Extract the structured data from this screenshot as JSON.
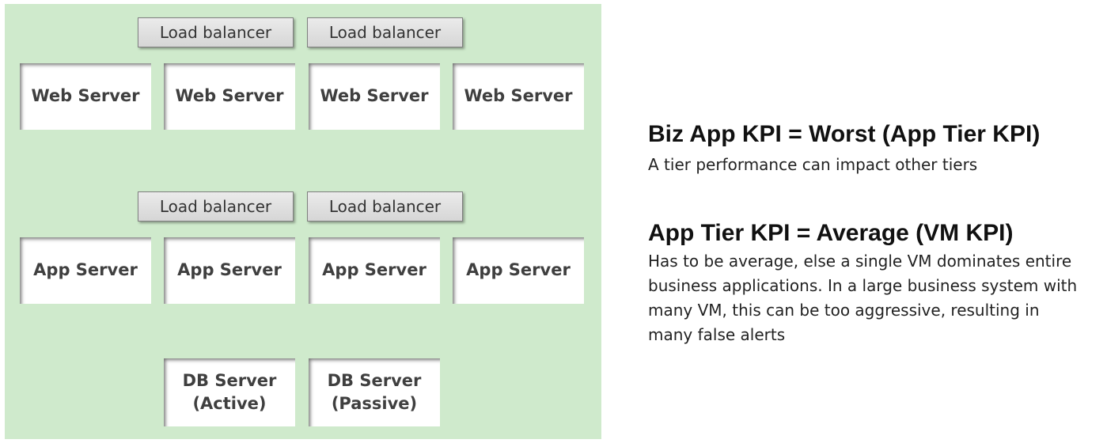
{
  "diagram": {
    "web_tier": {
      "load_balancers": [
        "Load balancer",
        "Load balancer"
      ],
      "servers": [
        "Web Server",
        "Web Server",
        "Web Server",
        "Web Server"
      ]
    },
    "app_tier": {
      "load_balancers": [
        "Load balancer",
        "Load balancer"
      ],
      "servers": [
        "App Server",
        "App Server",
        "App Server",
        "App Server"
      ]
    },
    "db_tier": {
      "servers": [
        "DB Server\n(Active)",
        "DB Server\n(Passive)"
      ]
    },
    "background_color": "#cfeacc"
  },
  "notes": {
    "biz_heading": "Biz App KPI = Worst (App Tier KPI)",
    "biz_body": "A tier performance can impact other tiers",
    "app_heading": "App Tier KPI = Average (VM KPI)",
    "app_body_lines": [
      "Has to be average, else a single VM dominates entire",
      "business applications. In a large business system with",
      "many VM, this can be too aggressive, resulting in",
      "many false alerts"
    ]
  }
}
